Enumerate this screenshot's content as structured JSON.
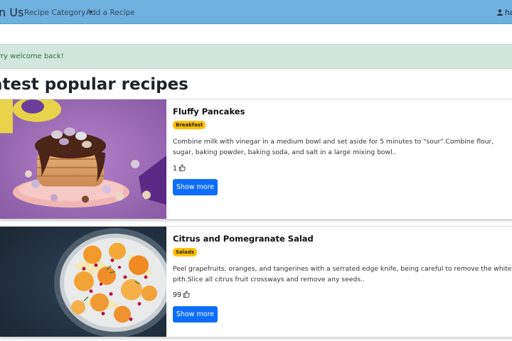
{
  "navbar": {
    "brand": "n Us",
    "links": [
      {
        "label": "Recipe Category"
      },
      {
        "label": "Add a Recipe"
      }
    ],
    "user": "ha"
  },
  "alert": {
    "text": "rry welcome back!"
  },
  "heading": "atest popular recipes",
  "recipes": [
    {
      "title": "Fluffy Pancakes",
      "category": "Breakfast",
      "description": "Combine milk with vinegar in a medium bowl and set aside for 5 minutes to \"sour\".Combine flour, sugar, baking powder, baking soda, and salt in a large mixing bowl..",
      "likes": "1",
      "button": "Show more"
    },
    {
      "title": "Citrus and Pomegranate Salad",
      "category": "Salads",
      "description": "Peel grapefruits, oranges, and tangerines with a serrated edge knife, being careful to remove the white pith.Slice all citrus fruit crossways and remove any seeds..",
      "likes": "99",
      "button": "Show more"
    }
  ],
  "colors": {
    "navbar": "#6fb0df",
    "alert_bg": "#d1e7dd",
    "badge": "#ffc107",
    "primary_button": "#0d6efd"
  },
  "icons": {
    "user": "user-icon",
    "like": "thumbs-up-icon",
    "dropdown": "caret-down-icon"
  }
}
